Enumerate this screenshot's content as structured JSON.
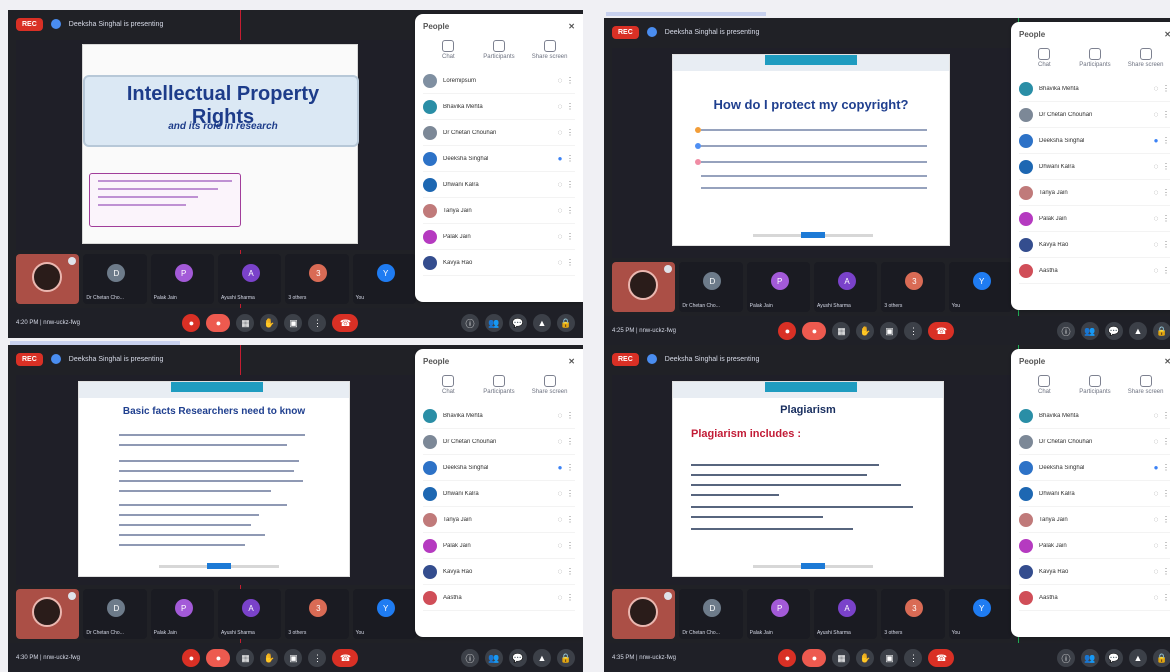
{
  "shots": [
    {
      "rec": "REC",
      "presenter": "Deeksha Singhal is presenting",
      "slide": {
        "title": "Intellectual Property Rights",
        "subtitle": "and its role in research"
      },
      "tiles": [
        {
          "label": "",
          "initial": "",
          "color": "#9c4f44"
        },
        {
          "label": "Dr Chetan Cho...",
          "initial": "D",
          "color": "#6d7b8a"
        },
        {
          "label": "Palak Jain",
          "initial": "P",
          "color": "#a35ad8"
        },
        {
          "label": "Ayushi Sharma",
          "initial": "A",
          "color": "#7a42ca"
        },
        {
          "label": "3 others",
          "initial": "3",
          "color": "#d96b55"
        },
        {
          "label": "You",
          "initial": "Y",
          "color": "#1f7cf2"
        }
      ],
      "meta": "4:20 PM  |  nnw-uckz-fwg",
      "panel": {
        "title": "People",
        "actions": [
          "Chat",
          "Participants",
          "Share screen"
        ],
        "people": [
          {
            "name": "Loremipsum",
            "color": "#7f8fa1",
            "icon": "◌"
          },
          {
            "name": "Bhavika Mehta",
            "color": "#2a8ea6",
            "icon": "◌"
          },
          {
            "name": "Dr Chetan Chouhan",
            "color": "#7c8897",
            "icon": "◌"
          },
          {
            "name": "Deeksha Singhal",
            "color": "#2d72c7",
            "icon": "●"
          },
          {
            "name": "Dhwani Kalra",
            "color": "#1d67b2",
            "icon": "◌"
          },
          {
            "name": "Tanya Jain",
            "color": "#c07a7a",
            "icon": "◌"
          },
          {
            "name": "Palak Jain",
            "color": "#b53ac0",
            "icon": "◌"
          },
          {
            "name": "Kavya Rao",
            "color": "#344d8e",
            "icon": "◌"
          }
        ]
      }
    },
    {
      "rec": "REC",
      "presenter": "Deeksha Singhal is presenting",
      "slide": {
        "title": "How do I protect my copyright?"
      },
      "tiles": [
        {
          "label": "",
          "initial": "",
          "color": "#9c4f44"
        },
        {
          "label": "Dr Chetan Cho...",
          "initial": "D",
          "color": "#6d7b8a"
        },
        {
          "label": "Palak Jain",
          "initial": "P",
          "color": "#a35ad8"
        },
        {
          "label": "Ayushi Sharma",
          "initial": "A",
          "color": "#7a42ca"
        },
        {
          "label": "3 others",
          "initial": "3",
          "color": "#d96b55"
        },
        {
          "label": "You",
          "initial": "Y",
          "color": "#1f7cf2"
        }
      ],
      "meta": "4:25 PM  |  nnw-uckz-fwg",
      "panel": {
        "title": "People",
        "actions": [
          "Chat",
          "Participants",
          "Share screen"
        ],
        "people": [
          {
            "name": "Bhavika Mehta",
            "color": "#2a8ea6",
            "icon": "◌"
          },
          {
            "name": "Dr Chetan Chouhan",
            "color": "#7c8897",
            "icon": "◌"
          },
          {
            "name": "Deeksha Singhal",
            "color": "#2d72c7",
            "icon": "●"
          },
          {
            "name": "Dhwani Kalra",
            "color": "#1d67b2",
            "icon": "◌"
          },
          {
            "name": "Tanya Jain",
            "color": "#c07a7a",
            "icon": "◌"
          },
          {
            "name": "Palak Jain",
            "color": "#b53ac0",
            "icon": "◌"
          },
          {
            "name": "Kavya Rao",
            "color": "#344d8e",
            "icon": "◌"
          },
          {
            "name": "Aastha",
            "color": "#d04e58",
            "icon": "◌"
          }
        ]
      }
    },
    {
      "rec": "REC",
      "presenter": "Deeksha Singhal is presenting",
      "slide": {
        "title": "Basic facts Researchers need to know"
      },
      "tiles": [
        {
          "label": "",
          "initial": "",
          "color": "#9c4f44"
        },
        {
          "label": "Dr Chetan Cho...",
          "initial": "D",
          "color": "#6d7b8a"
        },
        {
          "label": "Palak Jain",
          "initial": "P",
          "color": "#a35ad8"
        },
        {
          "label": "Ayushi Sharma",
          "initial": "A",
          "color": "#7a42ca"
        },
        {
          "label": "3 others",
          "initial": "3",
          "color": "#d96b55"
        },
        {
          "label": "You",
          "initial": "Y",
          "color": "#1f7cf2"
        }
      ],
      "meta": "4:30 PM  |  nnw-uckz-fwg",
      "panel": {
        "title": "People",
        "actions": [
          "Chat",
          "Participants",
          "Share screen"
        ],
        "people": [
          {
            "name": "Bhavika Mehta",
            "color": "#2a8ea6",
            "icon": "◌"
          },
          {
            "name": "Dr Chetan Chouhan",
            "color": "#7c8897",
            "icon": "◌"
          },
          {
            "name": "Deeksha Singhal",
            "color": "#2d72c7",
            "icon": "●"
          },
          {
            "name": "Dhwani Kalra",
            "color": "#1d67b2",
            "icon": "◌"
          },
          {
            "name": "Tanya Jain",
            "color": "#c07a7a",
            "icon": "◌"
          },
          {
            "name": "Palak Jain",
            "color": "#b53ac0",
            "icon": "◌"
          },
          {
            "name": "Kavya Rao",
            "color": "#344d8e",
            "icon": "◌"
          },
          {
            "name": "Aastha",
            "color": "#d04e58",
            "icon": "◌"
          }
        ]
      }
    },
    {
      "rec": "REC",
      "presenter": "Deeksha Singhal is presenting",
      "slide": {
        "title": "Plagiarism",
        "subtitle": "Plagiarism includes :"
      },
      "tiles": [
        {
          "label": "",
          "initial": "",
          "color": "#9c4f44"
        },
        {
          "label": "Dr Chetan Cho...",
          "initial": "D",
          "color": "#6d7b8a"
        },
        {
          "label": "Palak Jain",
          "initial": "P",
          "color": "#a35ad8"
        },
        {
          "label": "Ayushi Sharma",
          "initial": "A",
          "color": "#7a42ca"
        },
        {
          "label": "3 others",
          "initial": "3",
          "color": "#d96b55"
        },
        {
          "label": "You",
          "initial": "Y",
          "color": "#1f7cf2"
        }
      ],
      "meta": "4:35 PM  |  nnw-uckz-fwg",
      "panel": {
        "title": "People",
        "actions": [
          "Chat",
          "Participants",
          "Share screen"
        ],
        "people": [
          {
            "name": "Bhavika Mehta",
            "color": "#2a8ea6",
            "icon": "◌"
          },
          {
            "name": "Dr Chetan Chouhan",
            "color": "#7c8897",
            "icon": "◌"
          },
          {
            "name": "Deeksha Singhal",
            "color": "#2d72c7",
            "icon": "●"
          },
          {
            "name": "Dhwani Kalra",
            "color": "#1d67b2",
            "icon": "◌"
          },
          {
            "name": "Tanya Jain",
            "color": "#c07a7a",
            "icon": "◌"
          },
          {
            "name": "Palak Jain",
            "color": "#b53ac0",
            "icon": "◌"
          },
          {
            "name": "Kavya Rao",
            "color": "#344d8e",
            "icon": "◌"
          },
          {
            "name": "Aastha",
            "color": "#d04e58",
            "icon": "◌"
          }
        ]
      }
    }
  ]
}
